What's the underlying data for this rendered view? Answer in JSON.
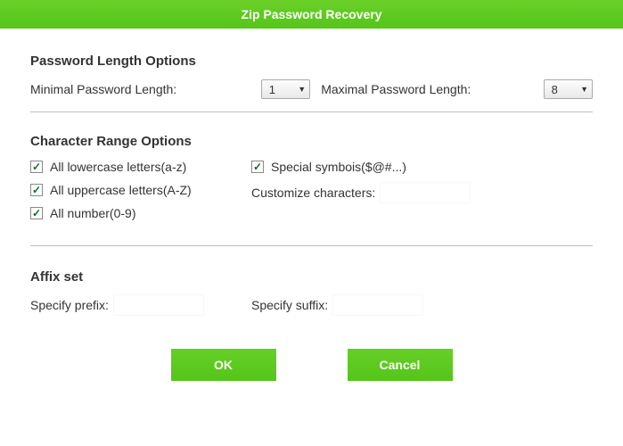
{
  "title": "Zip Password Recovery",
  "sections": {
    "length": {
      "heading": "Password Length Options",
      "min_label": "Minimal Password Length:",
      "min_value": "1",
      "max_label": "Maximal Password Length:",
      "max_value": "8"
    },
    "chars": {
      "heading": "Character Range Options",
      "lowercase": "All lowercase letters(a-z)",
      "uppercase": "All uppercase letters(A-Z)",
      "numbers": "All number(0-9)",
      "symbols": "Special symbois($@#...)",
      "customize_label": "Customize characters:",
      "customize_value": ""
    },
    "affix": {
      "heading": "Affix set",
      "prefix_label": "Specify prefix:",
      "prefix_value": "",
      "suffix_label": "Specify suffix:",
      "suffix_value": ""
    }
  },
  "buttons": {
    "ok": "OK",
    "cancel": "Cancel"
  },
  "checked": {
    "lowercase": true,
    "uppercase": true,
    "numbers": true,
    "symbols": true
  }
}
